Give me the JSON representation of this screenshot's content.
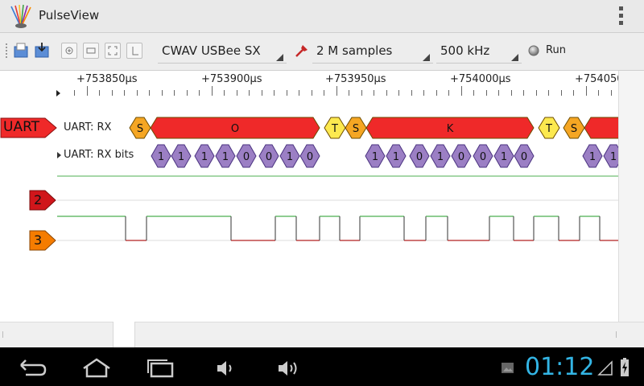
{
  "app": {
    "title": "PulseView"
  },
  "toolbar": {
    "device": "CWAV USBee SX",
    "samples": "2 M samples",
    "samplerate": "500 kHz",
    "run_label": "Run"
  },
  "ruler": {
    "labels": [
      "+753850µs",
      "+753900µs",
      "+753950µs",
      "+754000µs",
      "+754050"
    ]
  },
  "decoder": {
    "name": "UART",
    "row_rx_label": "UART: RX",
    "row_bits_label": "UART: RX bits",
    "rx_annotations": [
      "S",
      "O",
      "T",
      "S",
      "K",
      "T",
      "S"
    ],
    "bits": [
      "1",
      "1",
      "1",
      "1",
      "0",
      "0",
      "1",
      "0",
      "1",
      "1",
      "0",
      "1",
      "0",
      "0",
      "1",
      "0",
      "1",
      "1"
    ]
  },
  "channels": [
    {
      "label": "2",
      "color": "#d0161b"
    },
    {
      "label": "3",
      "color": "#f57c00"
    }
  ],
  "statusbar": {
    "time": "01:12"
  },
  "colors": {
    "rx_data": "#ef2929",
    "start_bit": "#f5a623",
    "stop_bit": "#fce94f",
    "bits": "#9b7fc4",
    "signal_high": "#4caf50",
    "signal_low": "#b22020"
  }
}
